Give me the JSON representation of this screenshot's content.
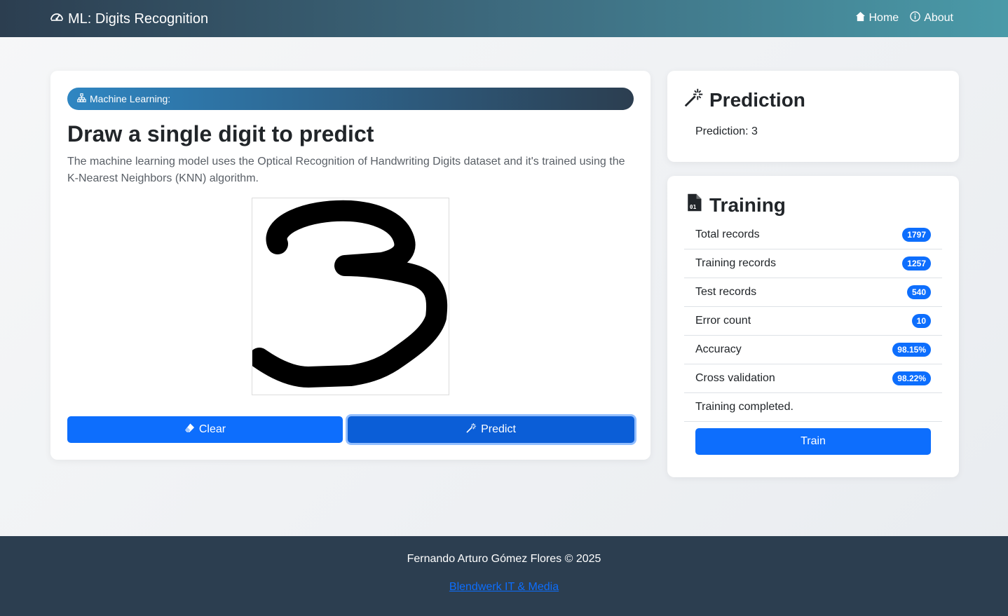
{
  "navbar": {
    "brand": "ML: Digits Recognition",
    "links": [
      {
        "label": "Home",
        "icon": "house-icon"
      },
      {
        "label": "About",
        "icon": "info-circle-icon"
      }
    ]
  },
  "main": {
    "pill_label": "Machine Learning:",
    "title": "Draw a single digit to predict",
    "description": "The machine learning model uses the Optical Recognition of Handwriting Digits dataset and it's trained using the K-Nearest Neighbors (KNN) algorithm.",
    "clear_label": "Clear",
    "predict_label": "Predict"
  },
  "prediction": {
    "title": "Prediction",
    "text": "Prediction: 3"
  },
  "training": {
    "title": "Training",
    "items": [
      {
        "label": "Total records",
        "value": "1797"
      },
      {
        "label": "Training records",
        "value": "1257"
      },
      {
        "label": "Test records",
        "value": "540"
      },
      {
        "label": "Error count",
        "value": "10"
      },
      {
        "label": "Accuracy",
        "value": "98.15%"
      },
      {
        "label": "Cross validation",
        "value": "98.22%"
      }
    ],
    "status": "Training completed.",
    "train_label": "Train"
  },
  "footer": {
    "text": "Fernando Arturo Gómez Flores © 2025",
    "link": "Blendwerk IT & Media"
  },
  "colors": {
    "primary": "#0d6efd",
    "footer_bg": "#2c3e50"
  }
}
